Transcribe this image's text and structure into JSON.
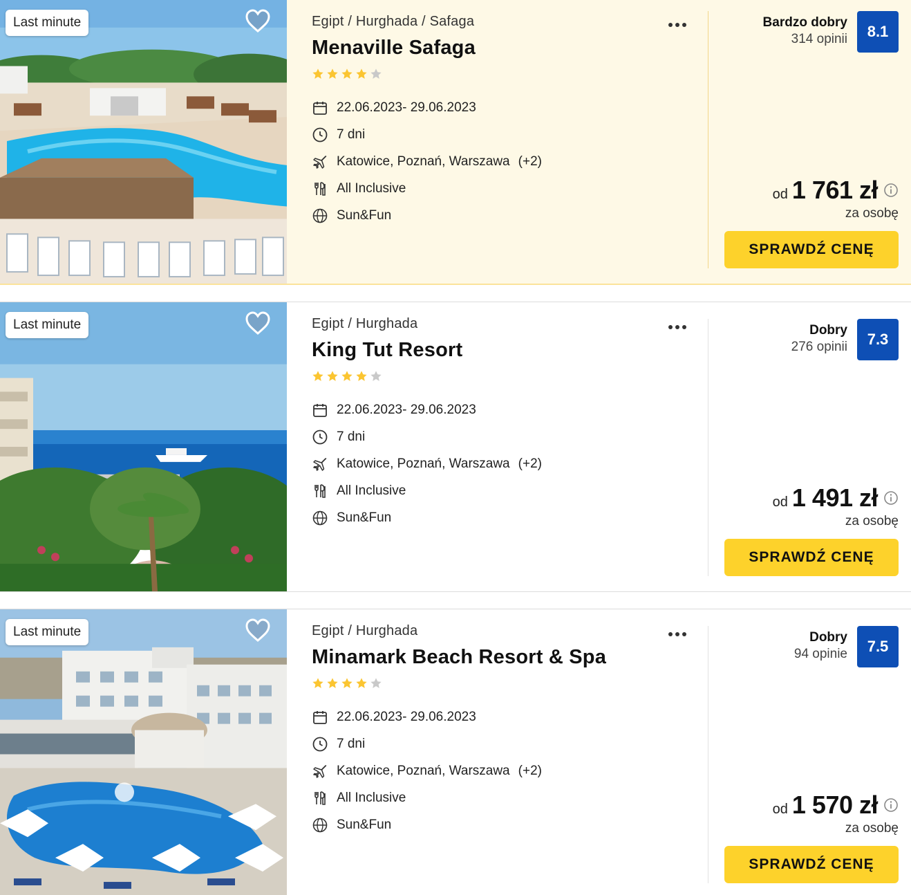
{
  "offers": [
    {
      "badge": "Last minute",
      "breadcrumb": "Egipt / Hurghada / Safaga",
      "name": "Menaville Safaga",
      "stars": 4,
      "max_stars": 5,
      "dates": "22.06.2023- 29.06.2023",
      "duration": "7 dni",
      "departure": "Katowice, Poznań, Warszawa",
      "departure_extra": "(+2)",
      "board": "All Inclusive",
      "category": "Sun&Fun",
      "rating_label": "Bardzo dobry",
      "reviews": "314 opinii",
      "score": "8.1",
      "price_prefix": "od",
      "price": "1 761 zł",
      "per_person": "za osobę",
      "cta": "SPRAWDŹ CENĘ",
      "highlighted": true
    },
    {
      "badge": "Last minute",
      "breadcrumb": "Egipt / Hurghada",
      "name": "King Tut Resort",
      "stars": 4,
      "max_stars": 5,
      "dates": "22.06.2023- 29.06.2023",
      "duration": "7 dni",
      "departure": "Katowice, Poznań, Warszawa",
      "departure_extra": "(+2)",
      "board": "All Inclusive",
      "category": "Sun&Fun",
      "rating_label": "Dobry",
      "reviews": "276 opinii",
      "score": "7.3",
      "price_prefix": "od",
      "price": "1 491 zł",
      "per_person": "za osobę",
      "cta": "SPRAWDŹ CENĘ",
      "highlighted": false
    },
    {
      "badge": "Last minute",
      "breadcrumb": "Egipt / Hurghada",
      "name": "Minamark Beach Resort & Spa",
      "stars": 4,
      "max_stars": 5,
      "dates": "22.06.2023- 29.06.2023",
      "duration": "7 dni",
      "departure": "Katowice, Poznań, Warszawa",
      "departure_extra": "(+2)",
      "board": "All Inclusive",
      "category": "Sun&Fun",
      "rating_label": "Dobry",
      "reviews": "94 opinie",
      "score": "7.5",
      "price_prefix": "od",
      "price": "1 570 zł",
      "per_person": "za osobę",
      "cta": "SPRAWDŹ CENĘ",
      "highlighted": false
    }
  ],
  "icons": {
    "favorite": "heart-icon",
    "more": "more-dots-icon",
    "dates": "calendar-icon",
    "duration": "clock-icon",
    "departure": "plane-icon",
    "board": "fork-knife-icon",
    "category": "globe-icon",
    "price_info": "info-icon"
  },
  "colors": {
    "accent_button": "#fdd22b",
    "score_badge": "#0e4fb5",
    "star_filled": "#fbc531",
    "star_empty": "#c9c9c9",
    "highlight_bg": "#fef9e6"
  }
}
